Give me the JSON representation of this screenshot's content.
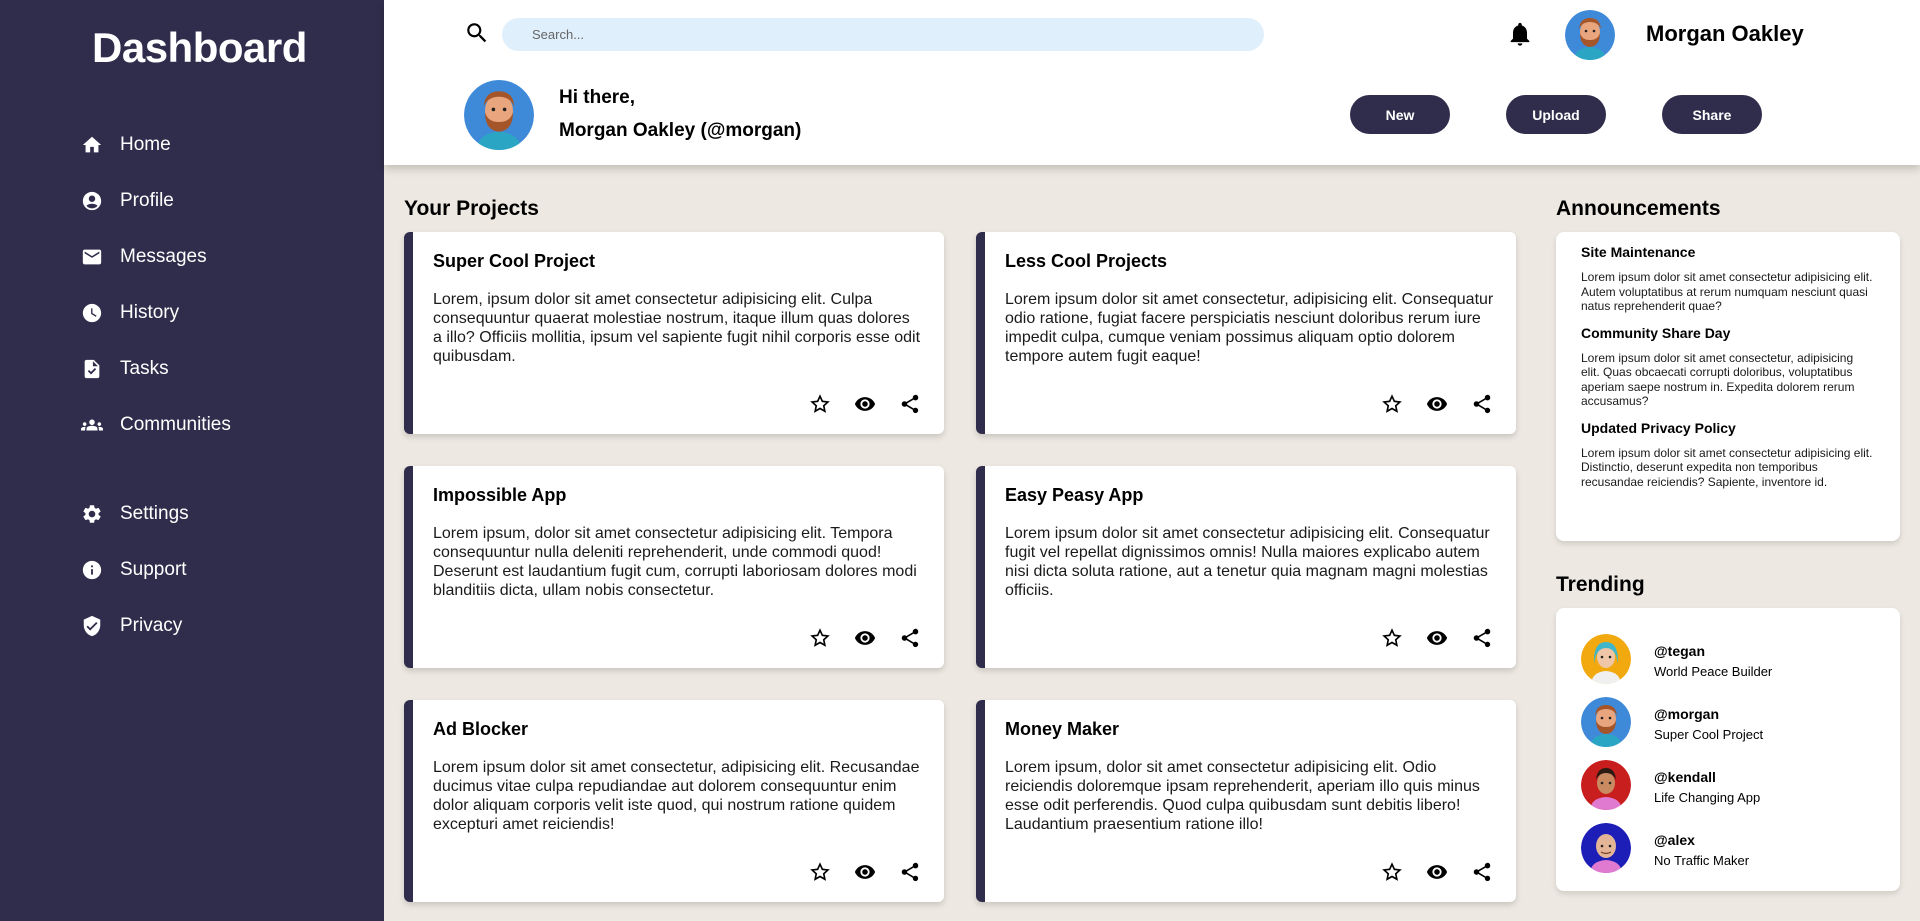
{
  "sidebar": {
    "brand": "Dashboard",
    "items": [
      {
        "label": "Home",
        "icon": "home-icon"
      },
      {
        "label": "Profile",
        "icon": "account-circle-icon"
      },
      {
        "label": "Messages",
        "icon": "mail-icon"
      },
      {
        "label": "History",
        "icon": "clock-icon"
      },
      {
        "label": "Tasks",
        "icon": "task-file-icon"
      },
      {
        "label": "Communities",
        "icon": "group-icon"
      }
    ],
    "secondary_items": [
      {
        "label": "Settings",
        "icon": "gear-icon"
      },
      {
        "label": "Support",
        "icon": "info-icon"
      },
      {
        "label": "Privacy",
        "icon": "shield-check-icon"
      }
    ]
  },
  "header": {
    "search_placeholder": "Search...",
    "user_name": "Morgan Oakley",
    "greeting_line1": "Hi there,",
    "greeting_line2": "Morgan Oakley (@morgan)",
    "buttons": {
      "new": "New",
      "upload": "Upload",
      "share": "Share"
    }
  },
  "projects": {
    "title": "Your Projects",
    "items": [
      {
        "title": "Super Cool Project",
        "body": "Lorem, ipsum dolor sit amet consectetur adipisicing elit. Culpa consequuntur quaerat molestiae nostrum, itaque illum quas dolores a illo? Officiis mollitia, ipsum vel sapiente fugit nihil corporis esse odit quibusdam."
      },
      {
        "title": "Less Cool Projects",
        "body": "Lorem ipsum dolor sit amet consectetur, adipisicing elit. Consequatur odio ratione, fugiat facere perspiciatis nesciunt doloribus rerum iure impedit culpa, cumque veniam possimus aliquam optio dolorem tempore autem fugit eaque!"
      },
      {
        "title": "Impossible App",
        "body": "Lorem ipsum, dolor sit amet consectetur adipisicing elit. Tempora consequuntur nulla deleniti reprehenderit, unde commodi quod! Deserunt est laudantium fugit cum, corrupti laboriosam dolores modi blanditiis dicta, ullam nobis consectetur."
      },
      {
        "title": "Easy Peasy App",
        "body": "Lorem ipsum dolor sit amet consectetur adipisicing elit. Consequatur fugit vel repellat dignissimos omnis! Nulla maiores explicabo autem nisi dicta soluta ratione, aut a tenetur quia magnam magni molestias officiis."
      },
      {
        "title": "Ad Blocker",
        "body": "Lorem ipsum dolor sit amet consectetur, adipisicing elit. Recusandae ducimus vitae culpa repudiandae aut dolorem consequuntur enim dolor aliquam corporis velit iste quod, qui nostrum ratione quidem excepturi amet reiciendis!"
      },
      {
        "title": "Money Maker",
        "body": "Lorem ipsum, dolor sit amet consectetur adipisicing elit. Odio reiciendis doloremque ipsam reprehenderit, aperiam illo quis minus esse odit perferendis. Quod culpa quibusdam sunt debitis libero! Laudantium praesentium ratione illo!"
      }
    ],
    "action_icons": [
      "star-icon",
      "eye-icon",
      "share-icon"
    ]
  },
  "announcements": {
    "title": "Announcements",
    "items": [
      {
        "title": "Site Maintenance",
        "body": "Lorem ipsum dolor sit amet consectetur adipisicing elit. Autem voluptatibus at rerum numquam nesciunt quasi natus reprehenderit quae?"
      },
      {
        "title": "Community Share Day",
        "body": "Lorem ipsum dolor sit amet consectetur, adipisicing elit. Quas obcaecati corrupti doloribus, voluptatibus aperiam saepe nostrum in. Expedita dolorem rerum accusamus?"
      },
      {
        "title": "Updated Privacy Policy",
        "body": "Lorem ipsum dolor sit amet consectetur adipisicing elit. Distinctio, deserunt expedita non temporibus recusandae reiciendis? Sapiente, inventore id."
      }
    ]
  },
  "trending": {
    "title": "Trending",
    "items": [
      {
        "handle": "@tegan",
        "project": "World Peace Builder",
        "bg": "#f2a90f"
      },
      {
        "handle": "@morgan",
        "project": "Super Cool Project",
        "bg": "#3f8ad8"
      },
      {
        "handle": "@kendall",
        "project": "Life Changing App",
        "bg": "#c81e1e"
      },
      {
        "handle": "@alex",
        "project": "No Traffic Maker",
        "bg": "#1d1db8"
      }
    ]
  },
  "colors": {
    "sidebar": "#2f2d4b",
    "background": "#ede8e1",
    "search": "#dfeffb"
  }
}
